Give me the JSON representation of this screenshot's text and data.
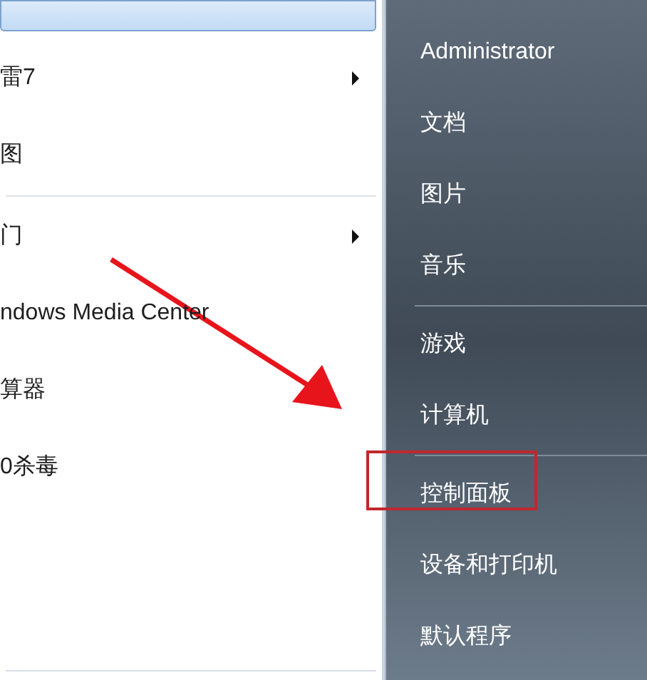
{
  "programs": [
    {
      "kind": "item",
      "selected": true,
      "has_submenu": false
    },
    {
      "kind": "item",
      "label": "雷7",
      "selected": false,
      "has_submenu": true
    },
    {
      "kind": "item",
      "label": "图",
      "selected": false,
      "has_submenu": false
    },
    {
      "kind": "divider"
    },
    {
      "kind": "item",
      "label": "门",
      "selected": false,
      "has_submenu": true
    },
    {
      "kind": "item",
      "label": "ndows Media Center",
      "selected": false,
      "has_submenu": false
    },
    {
      "kind": "item",
      "label": "算器",
      "selected": false,
      "has_submenu": false
    },
    {
      "kind": "item",
      "label": "0杀毒",
      "selected": false,
      "has_submenu": false
    }
  ],
  "places": [
    {
      "kind": "item",
      "label": "Administrator"
    },
    {
      "kind": "item",
      "label": "文档"
    },
    {
      "kind": "item",
      "label": "图片"
    },
    {
      "kind": "item",
      "label": "音乐"
    },
    {
      "kind": "divider"
    },
    {
      "kind": "item",
      "label": "游戏"
    },
    {
      "kind": "item",
      "label": "计算机"
    },
    {
      "kind": "divider"
    },
    {
      "kind": "item",
      "label": "控制面板",
      "highlighted": true
    },
    {
      "kind": "item",
      "label": "设备和打印机"
    },
    {
      "kind": "item",
      "label": "默认程序"
    }
  ]
}
